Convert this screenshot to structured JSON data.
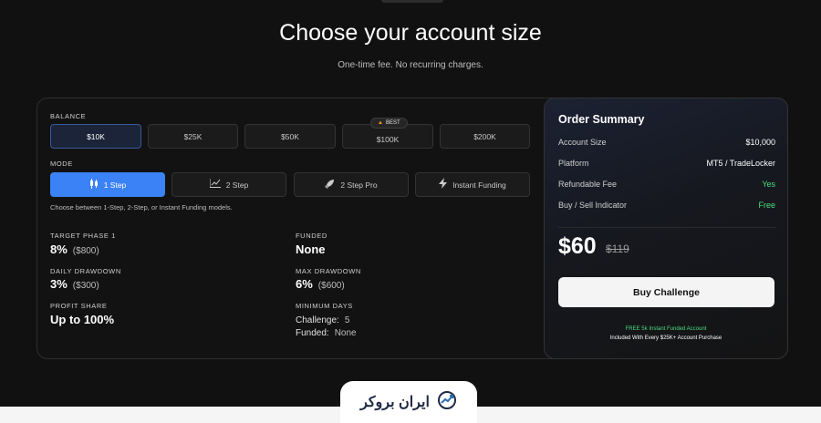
{
  "header": {
    "title": "Choose your account size",
    "subtitle": "One-time fee. No recurring charges."
  },
  "balance": {
    "label": "BALANCE",
    "options": [
      "$10K",
      "$25K",
      "$50K",
      "$100K",
      "$200K"
    ],
    "selected": "$10K",
    "badge": "BEST"
  },
  "mode": {
    "label": "MODE",
    "options": [
      {
        "label": "1 Step",
        "icon": "candlestick-icon"
      },
      {
        "label": "2 Step",
        "icon": "line-chart-icon"
      },
      {
        "label": "2 Step Pro",
        "icon": "rocket-icon"
      },
      {
        "label": "Instant Funding",
        "icon": "lightning-icon"
      }
    ],
    "selected": "1 Step",
    "helper": "Choose between 1-Step, 2-Step, or Instant Funding models."
  },
  "stats": {
    "target_phase_label": "TARGET PHASE 1",
    "target_phase_value": "8%",
    "target_phase_amount": "($800)",
    "funded_label": "FUNDED",
    "funded_value": "None",
    "daily_drawdown_label": "DAILY DRAWDOWN",
    "daily_drawdown_value": "3%",
    "daily_drawdown_amount": "($300)",
    "max_drawdown_label": "MAX DRAWDOWN",
    "max_drawdown_value": "6%",
    "max_drawdown_amount": "($600)",
    "profit_share_label": "PROFIT SHARE",
    "profit_share_value": "Up to 100%",
    "minimum_days_label": "MINIMUM DAYS",
    "challenge_label": "Challenge:",
    "challenge_value": "5",
    "funded_days_label": "Funded:",
    "funded_days_value": "None"
  },
  "summary": {
    "title": "Order Summary",
    "rows": [
      {
        "label": "Account Size",
        "value": "$10,000"
      },
      {
        "label": "Platform",
        "value": "MT5 / TradeLocker"
      },
      {
        "label": "Refundable Fee",
        "value": "Yes"
      },
      {
        "label": "Buy / Sell Indicator",
        "value": "Free"
      }
    ],
    "price": "$60",
    "old_price": "$119",
    "buy_label": "Buy Challenge",
    "promo_line1": "FREE 5k Instant Funded Account",
    "promo_line2": "Included With Every $25K+ Account Purchase"
  },
  "footer": {
    "logo_text": "ایران بروکر"
  },
  "colors": {
    "accent": "#3b82f6",
    "success": "#4ade80",
    "background": "#111111"
  }
}
